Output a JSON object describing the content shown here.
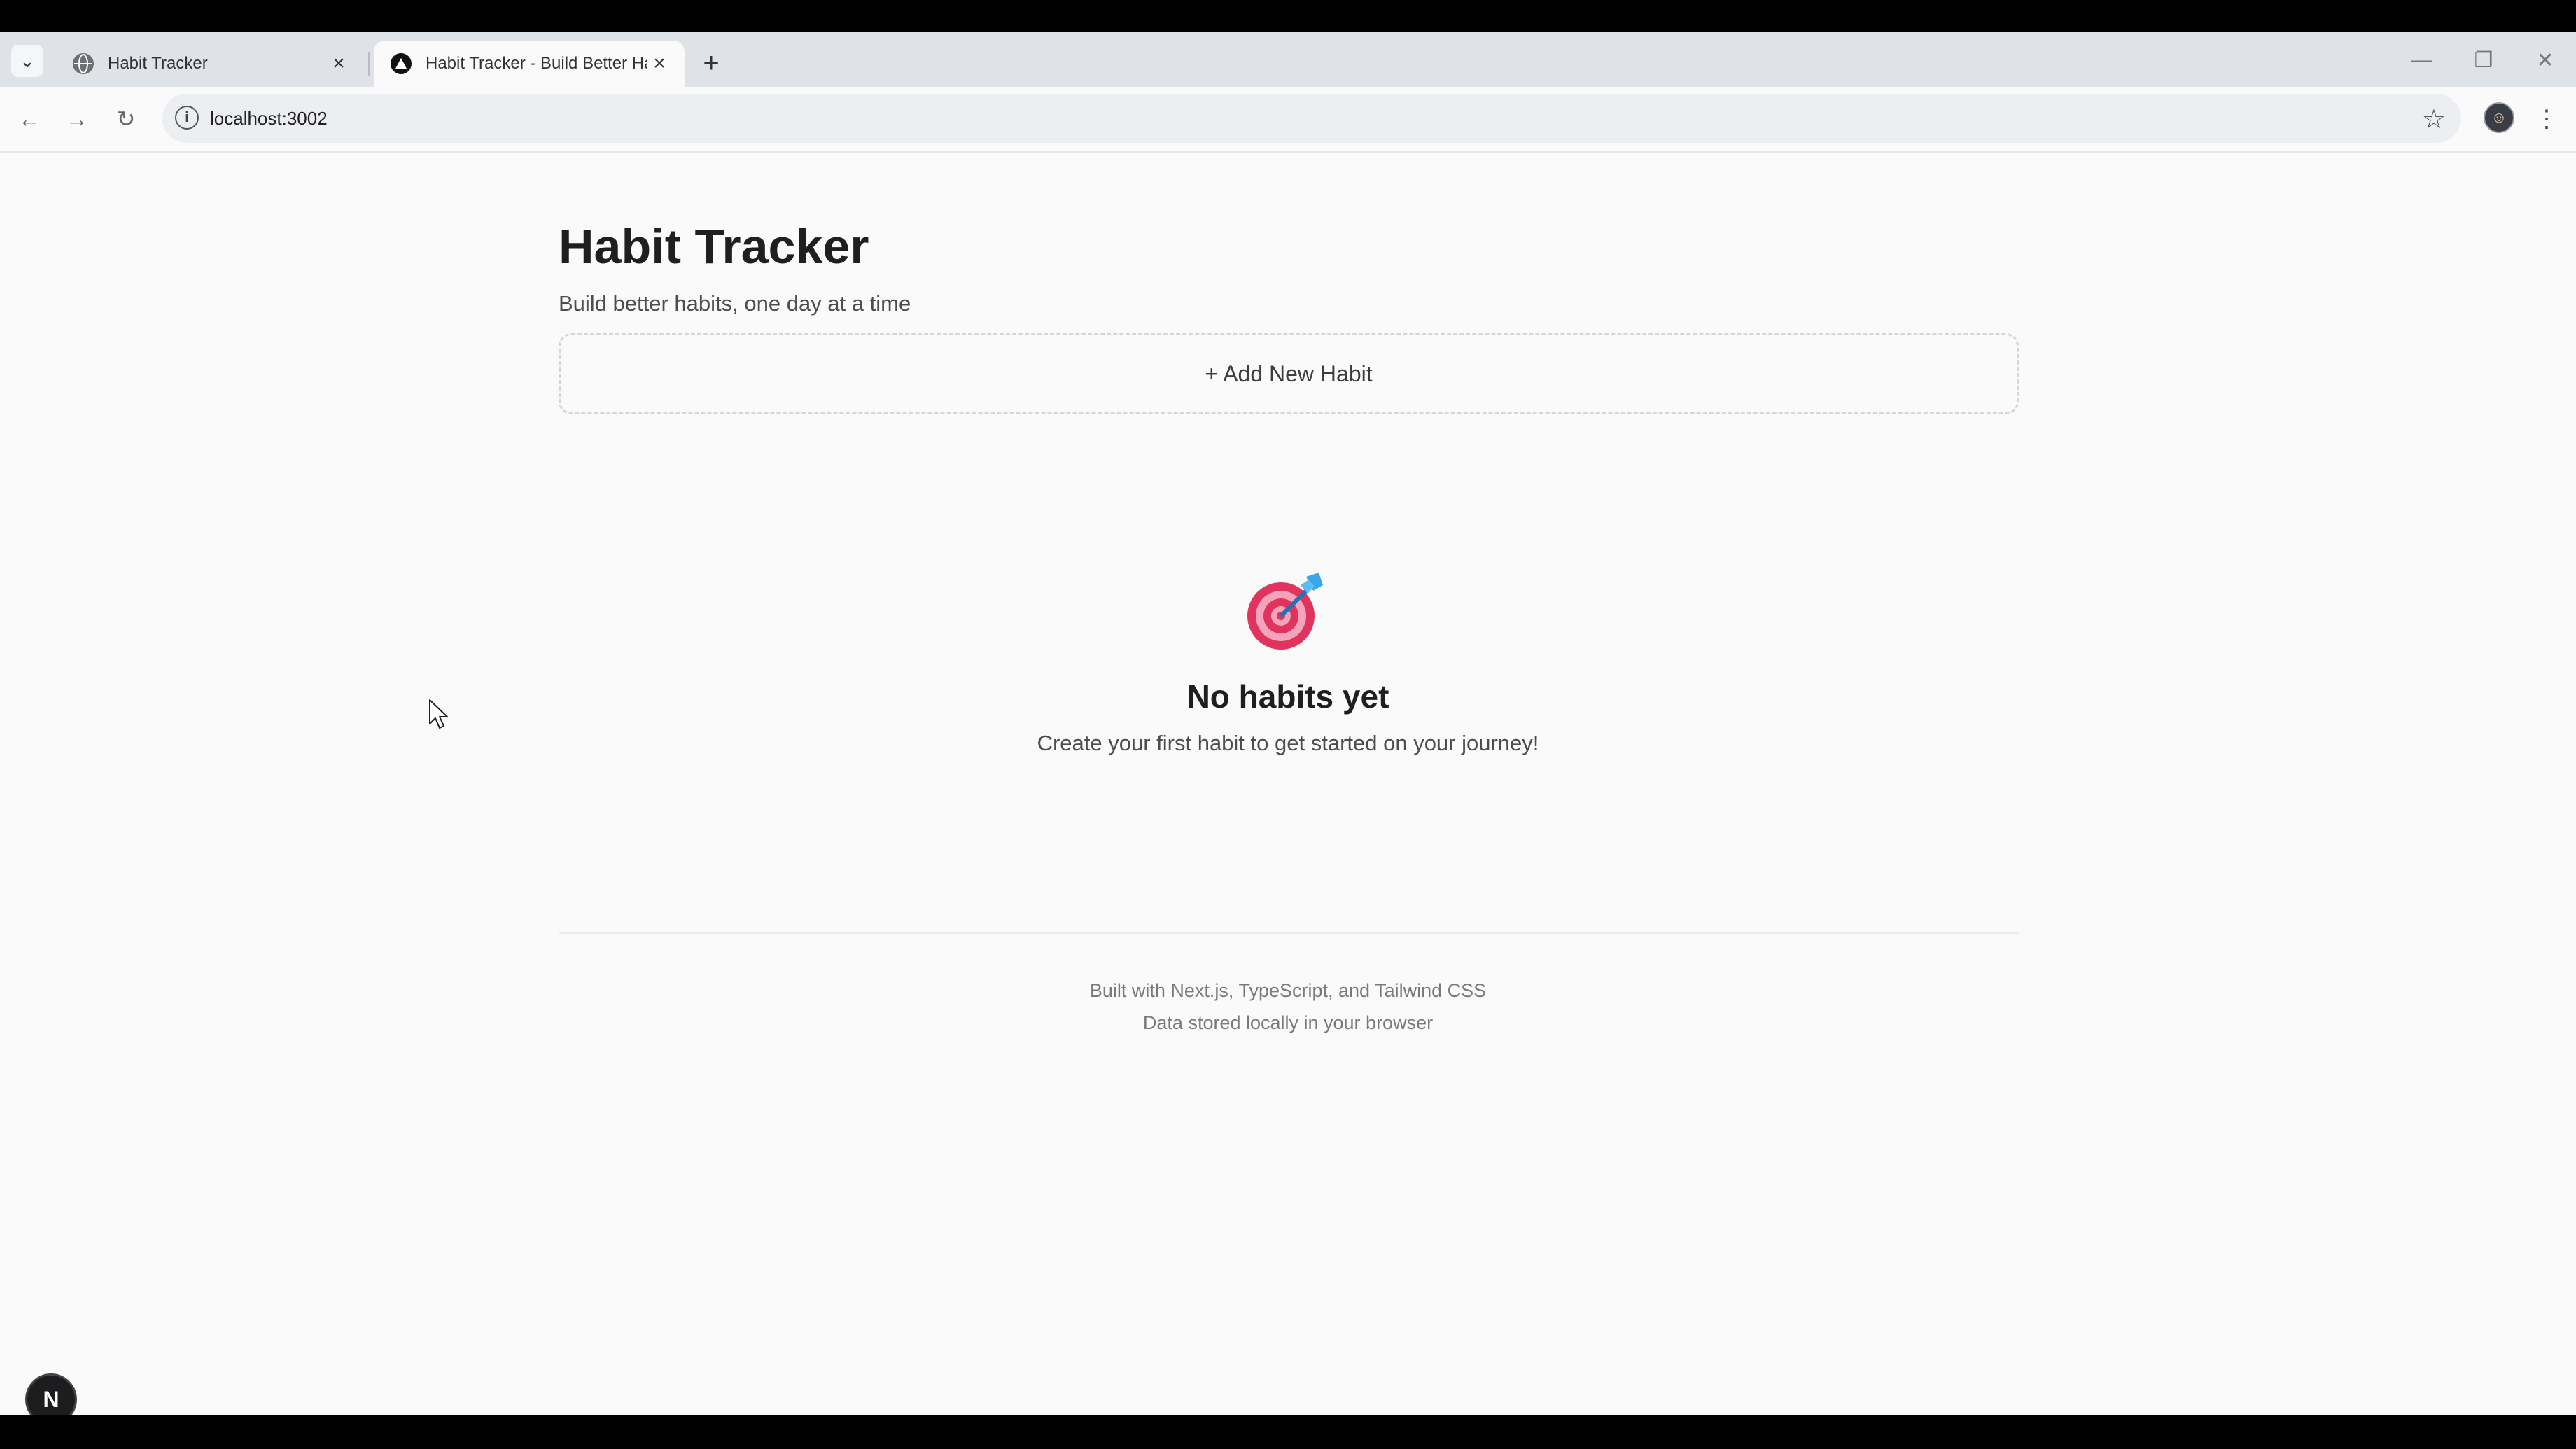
{
  "tabs": [
    {
      "title": "Habit Tracker",
      "close": "×",
      "favicon": "globe-icon"
    },
    {
      "title": "Habit Tracker - Build Better Habits",
      "close": "×",
      "favicon": "nextjs-triangle-icon"
    }
  ],
  "tabstrip": {
    "search_glyph": "⌄",
    "new_tab": "+",
    "minimize": "—",
    "restore": "❐",
    "close": "✕"
  },
  "toolbar": {
    "back": "←",
    "forward": "→",
    "reload": "↻",
    "info": "i",
    "url": "localhost:3002",
    "star": "☆",
    "avatar": "☺",
    "menu": "⋮"
  },
  "header": {
    "title": "Habit Tracker",
    "subtitle": "Build better habits, one day at a time"
  },
  "add_habit": {
    "label": "+ Add New Habit"
  },
  "empty_state": {
    "icon": "target-dart-icon",
    "title": "No habits yet",
    "description": "Create your first habit to get started on your journey!"
  },
  "footer": {
    "line1": "Built with Next.js, TypeScript, and Tailwind CSS",
    "line2": "Data stored locally in your browser"
  },
  "dev_badge": {
    "label": "N"
  },
  "colors": {
    "target_red": "#e0345f",
    "target_pink": "#f4a3bb",
    "dart_blue": "#3aa6e8"
  }
}
